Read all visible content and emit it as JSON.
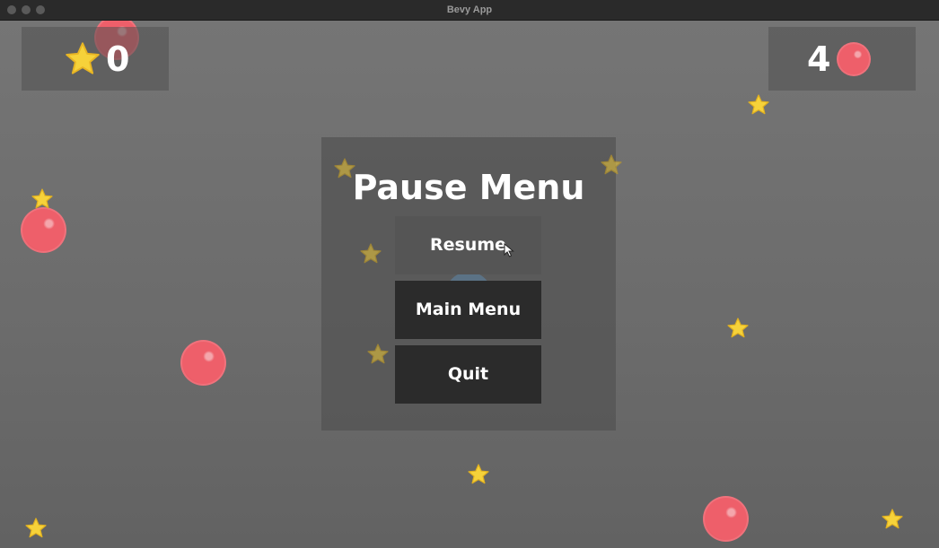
{
  "window": {
    "title": "Bevy App"
  },
  "hud": {
    "score": "0",
    "enemy_count": "4"
  },
  "pause_menu": {
    "title": "Pause Menu",
    "buttons": [
      {
        "label": "Resume",
        "state": "hovered"
      },
      {
        "label": "Main Menu",
        "state": "normal"
      },
      {
        "label": "Quit",
        "state": "normal"
      }
    ]
  },
  "icons": {
    "score_icon": "star-icon",
    "enemy_icon": "red-ball-icon"
  },
  "colors": {
    "background": "#6e6e6e",
    "star_fill": "#f6d23a",
    "ball_fill": "#ee5f6a",
    "button_bg": "#2b2b2b",
    "button_hover_bg": "#555555",
    "text": "#ffffff"
  }
}
